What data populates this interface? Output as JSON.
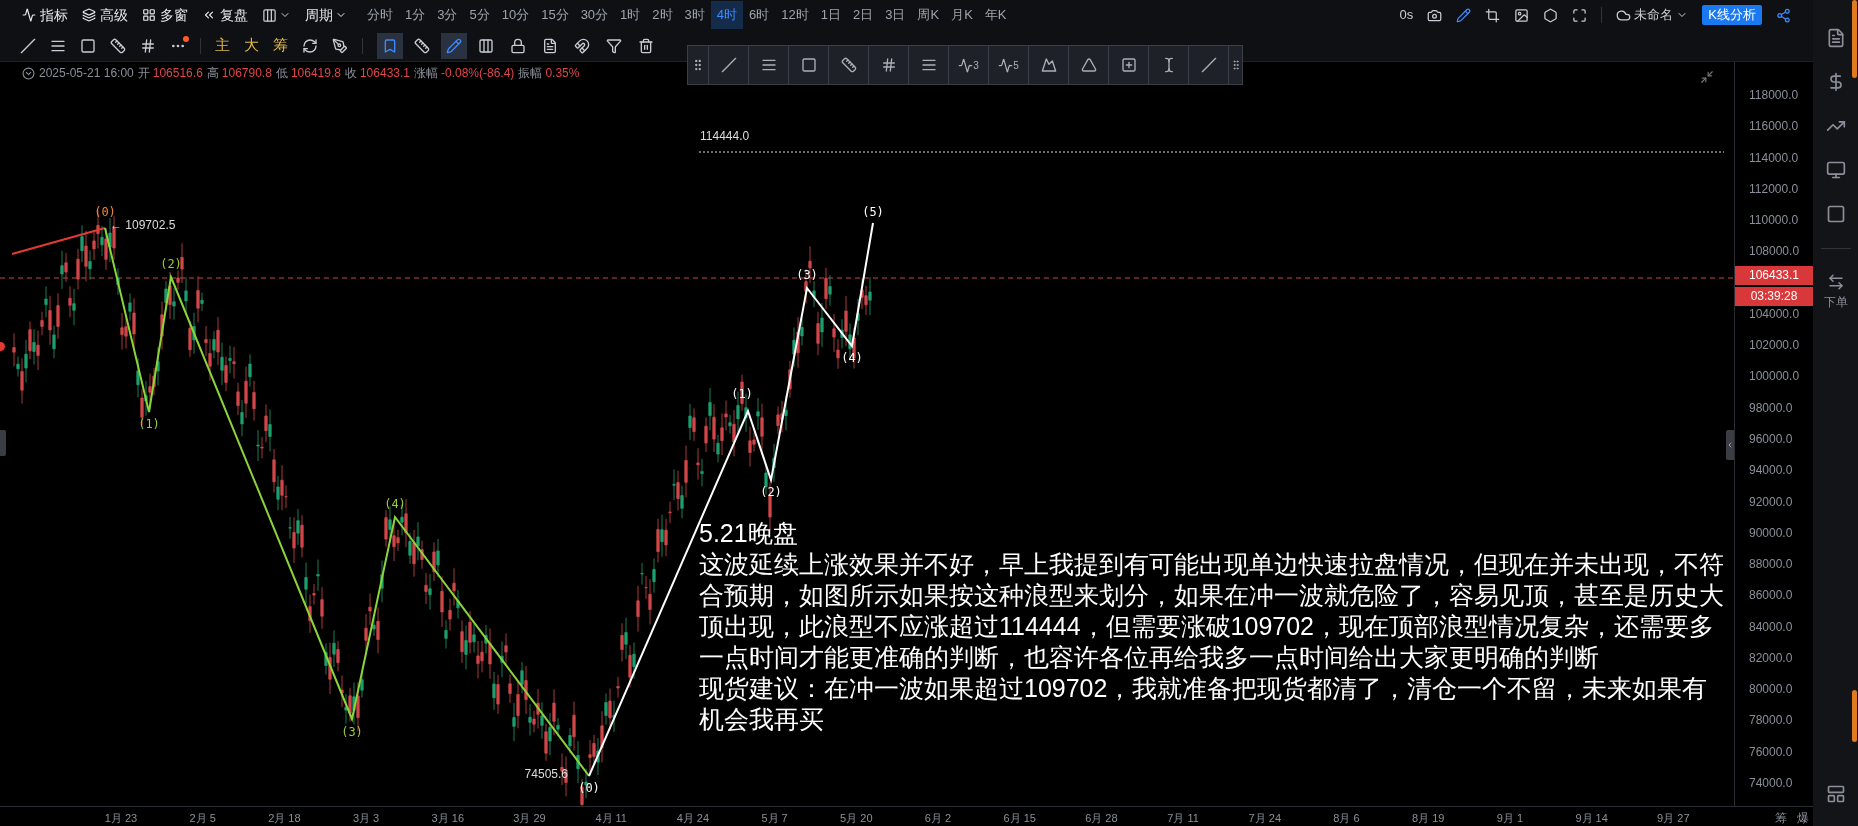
{
  "menu": [
    {
      "label": "指标"
    },
    {
      "label": "高级"
    },
    {
      "label": "多窗"
    },
    {
      "label": "复盘"
    }
  ],
  "period_label": "周期",
  "timeframes": [
    {
      "label": "分时",
      "selected": false
    },
    {
      "label": "1分",
      "selected": false
    },
    {
      "label": "3分",
      "selected": false
    },
    {
      "label": "5分",
      "selected": false
    },
    {
      "label": "10分",
      "selected": false
    },
    {
      "label": "15分",
      "selected": false
    },
    {
      "label": "30分",
      "selected": false
    },
    {
      "label": "1时",
      "selected": false
    },
    {
      "label": "2时",
      "selected": false
    },
    {
      "label": "3时",
      "selected": false
    },
    {
      "label": "4时",
      "selected": true
    },
    {
      "label": "6时",
      "selected": false
    },
    {
      "label": "12时",
      "selected": false
    },
    {
      "label": "1日",
      "selected": false
    },
    {
      "label": "2日",
      "selected": false
    },
    {
      "label": "3日",
      "selected": false
    },
    {
      "label": "周K",
      "selected": false
    },
    {
      "label": "月K",
      "selected": false
    },
    {
      "label": "年K",
      "selected": false
    }
  ],
  "status": "0s",
  "layout_name": "未命名",
  "analysis_button": "K线分析",
  "more_alert": true,
  "indicator_buttons": [
    "主",
    "大",
    "筹"
  ],
  "tools": [
    {
      "selected": true
    },
    {
      "selected": false
    },
    {
      "selected": true
    },
    {
      "selected": false
    },
    {
      "selected": false
    },
    {
      "selected": false
    },
    {
      "selected": false
    },
    {
      "selected": false
    },
    {
      "selected": false
    }
  ],
  "ohlc": {
    "datetime": "2025-05-21 16:00",
    "fields": [
      {
        "label": "开",
        "value": "106516.6"
      },
      {
        "label": "高",
        "value": "106790.8"
      },
      {
        "label": "低",
        "value": "106419.8"
      },
      {
        "label": "收",
        "value": "106433.1"
      },
      {
        "label": "涨幅",
        "value": "-0.08%(-86.4)"
      },
      {
        "label": "振幅",
        "value": "0.35%"
      }
    ]
  },
  "floating_toolbar": {
    "wave_subscripts": [
      "3",
      "5"
    ]
  },
  "chart": {
    "high_label": "← 109702.5",
    "low_label": "74505.6",
    "target_label": "114444.0",
    "wave_labels": [
      {
        "text": "(0)",
        "color": "#f0883e"
      },
      {
        "text": "(1)",
        "color": "#9ccc3a"
      },
      {
        "text": "(2)",
        "color": "#9ccc3a"
      },
      {
        "text": "(3)",
        "color": "#9ccc3a"
      },
      {
        "text": "(4)",
        "color": "#9ccc3a"
      },
      {
        "text": "(0)",
        "color": "#ffffff"
      },
      {
        "text": "(1)",
        "color": "#ffffff"
      },
      {
        "text": "(2)",
        "color": "#ffffff"
      },
      {
        "text": "(3)",
        "color": "#ffffff"
      },
      {
        "text": "(4)",
        "color": "#ffffff"
      },
      {
        "text": "(5)",
        "color": "#ffffff"
      }
    ]
  },
  "price_ticks": [
    "118000.0",
    "116000.0",
    "114000.0",
    "112000.0",
    "110000.0",
    "108000.0",
    "104000.0",
    "102000.0",
    "100000.0",
    "98000.0",
    "96000.0",
    "94000.0",
    "92000.0",
    "90000.0",
    "88000.0",
    "86000.0",
    "84000.0",
    "82000.0",
    "80000.0",
    "78000.0",
    "76000.0",
    "74000.0"
  ],
  "last_price": "106433.1",
  "countdown": "03:39:28",
  "date_ticks": [
    "1月 23",
    "2月 5",
    "2月 18",
    "3月 3",
    "3月 16",
    "3月 29",
    "4月 11",
    "4月 24",
    "5月 7",
    "5月 20",
    "6月 2",
    "6月 15",
    "6月 28",
    "7月 11",
    "7月 24",
    "8月 6",
    "8月 19",
    "9月 1",
    "9月 14",
    "9月 27"
  ],
  "corner_labels": [
    "筹",
    "爆"
  ],
  "note": {
    "title": "5.21晚盘",
    "paragraphs": [
      "这波延续上涨效果并不好，早上我提到有可能出现单边快速拉盘情况，但现在并未出现，不符合预期，如图所示如果按这种浪型来划分，如果在冲一波就危险了，容易见顶，甚至是历史大顶出现，此浪型不应涨超过114444，但需要涨破109702，现在顶部浪型情况复杂，还需要多一点时间才能更准确的判断，也容许各位再给我多一点时间给出大家更明确的判断",
      "现货建议：在冲一波如果超过109702，我就准备把现货都清了，清仓一个不留，未来如果有机会我再买"
    ]
  },
  "sidebar": {
    "order_label": "下单"
  }
}
